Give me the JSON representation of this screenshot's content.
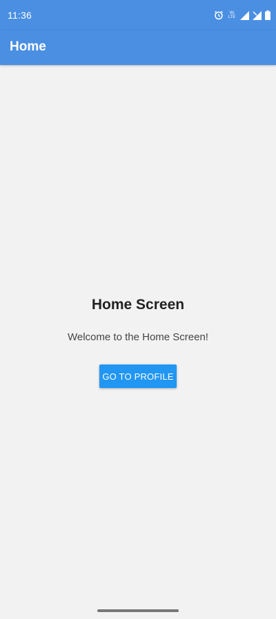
{
  "status_bar": {
    "time": "11:36",
    "volte_label": "Vo\nLTE",
    "icons": [
      "alarm-icon",
      "volte-icon",
      "signal-icon",
      "signal-no-data-icon",
      "battery-icon"
    ]
  },
  "app_bar": {
    "title": "Home"
  },
  "main": {
    "title": "Home Screen",
    "welcome_text": "Welcome to the Home Screen!",
    "button_label": "GO TO PROFILE"
  },
  "colors": {
    "app_bar": "#4a8fe2",
    "button": "#2196f3",
    "background": "#f2f2f2"
  }
}
